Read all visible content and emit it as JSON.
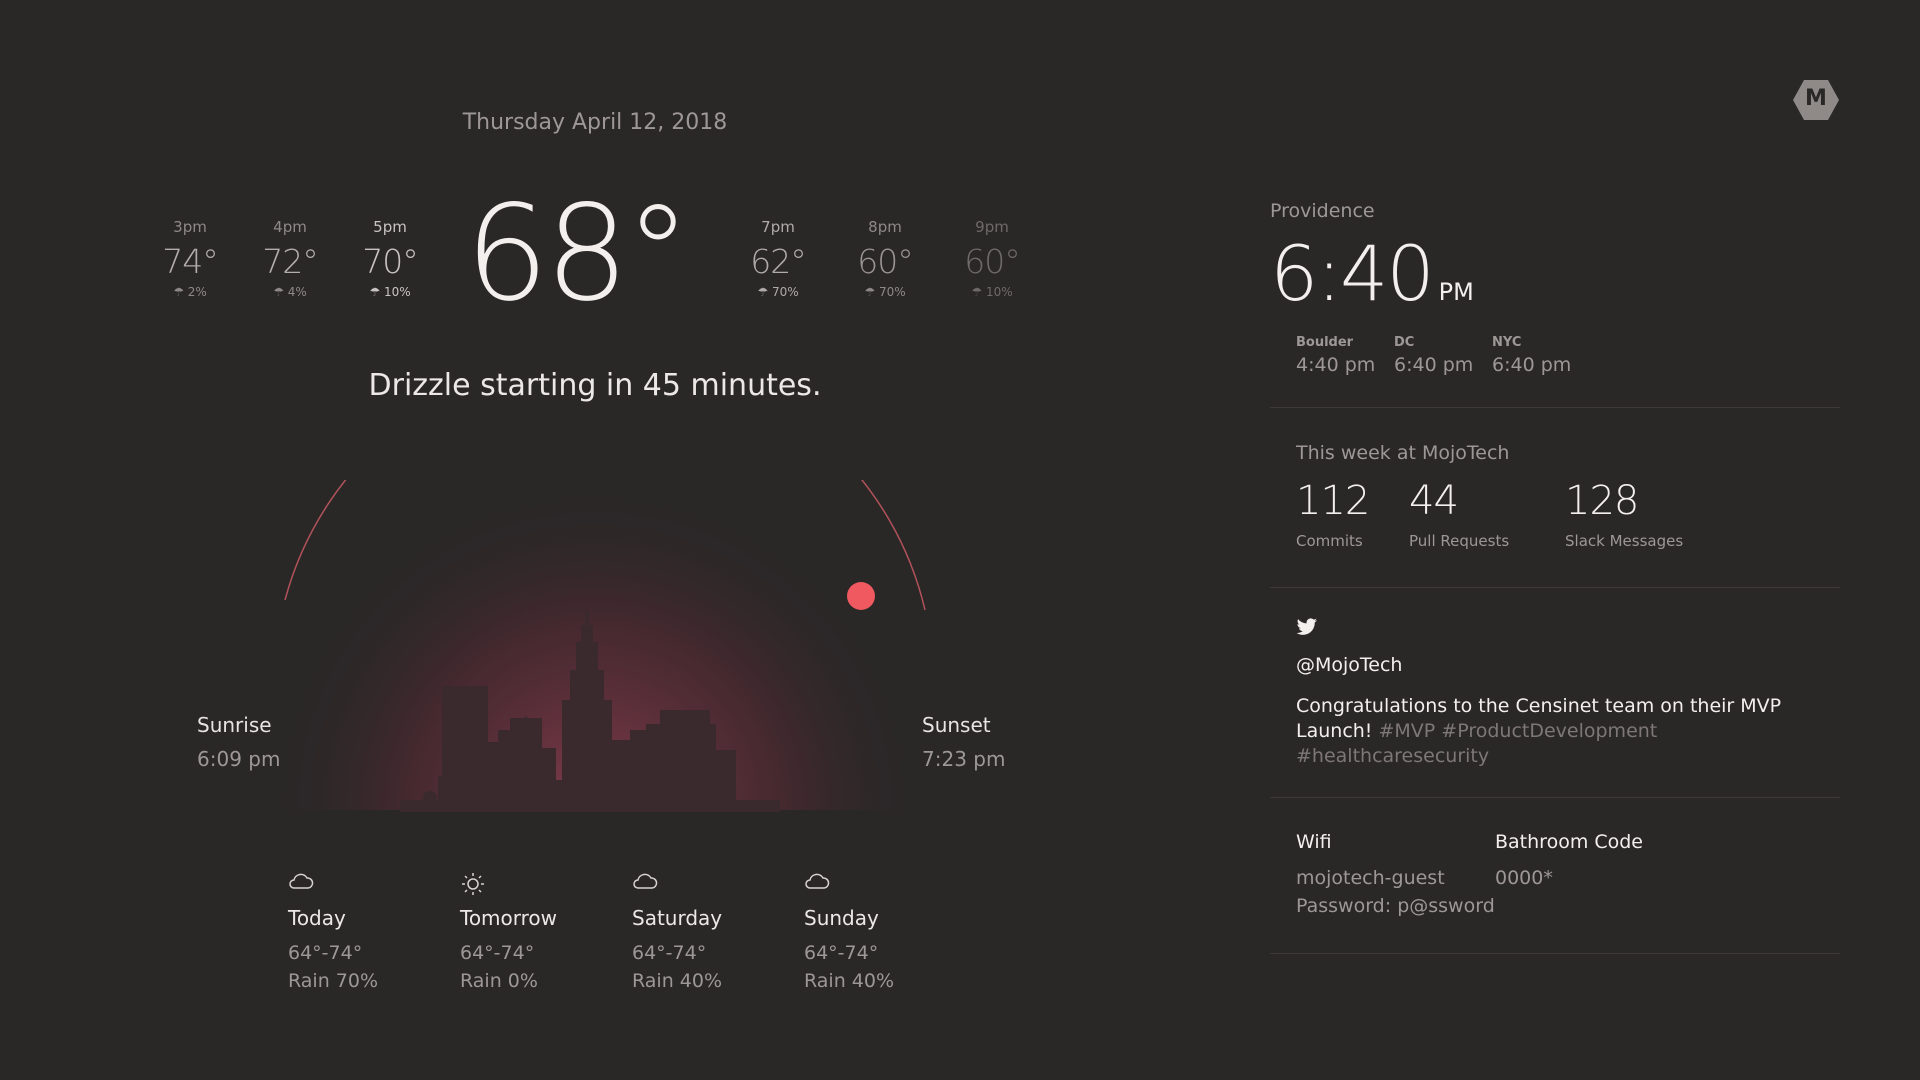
{
  "date": "Thursday April 12, 2018",
  "current_temp": "68°",
  "hourly_before": [
    {
      "time": "3pm",
      "temp": "74°",
      "rain": "2%"
    },
    {
      "time": "4pm",
      "temp": "72°",
      "rain": "4%"
    },
    {
      "time": "5pm",
      "temp": "70°",
      "rain": "10%"
    }
  ],
  "hourly_after": [
    {
      "time": "7pm",
      "temp": "62°",
      "rain": "70%"
    },
    {
      "time": "8pm",
      "temp": "60°",
      "rain": "70%"
    },
    {
      "time": "9pm",
      "temp": "60°",
      "rain": "10%"
    }
  ],
  "summary": "Drizzle starting in 45 minutes.",
  "sun": {
    "sunrise_label": "Sunrise",
    "sunrise_time": "6:09 pm",
    "sunset_label": "Sunset",
    "sunset_time": "7:23 pm",
    "arc_color": "#c85a63",
    "sun_color": "#f0595f"
  },
  "forecast": [
    {
      "icon": "cloud-icon",
      "day": "Today",
      "range": "64°-74°",
      "rain": "Rain 70%"
    },
    {
      "icon": "sun-icon",
      "day": "Tomorrow",
      "range": "64°-74°",
      "rain": "Rain 0%"
    },
    {
      "icon": "cloud-icon",
      "day": "Saturday",
      "range": "64°-74°",
      "rain": "Rain 40%"
    },
    {
      "icon": "cloud-icon",
      "day": "Sunday",
      "range": "64°-74°",
      "rain": "Rain 40%"
    }
  ],
  "logo": "M",
  "clock": {
    "city": "Providence",
    "time": "6:40",
    "ampm": "PM",
    "zones": [
      {
        "name": "Boulder",
        "time": "4:40 pm"
      },
      {
        "name": "DC",
        "time": "6:40 pm"
      },
      {
        "name": "NYC",
        "time": "6:40 pm"
      }
    ]
  },
  "week": {
    "title": "This week at MojoTech",
    "stats": [
      {
        "value": "112",
        "label": "Commits"
      },
      {
        "value": "44",
        "label": "Pull Requests"
      },
      {
        "value": "128",
        "label": "Slack Messages"
      }
    ]
  },
  "twitter": {
    "handle": "@MojoTech",
    "text": "Congratulations to the Censinet team on their MVP Launch!",
    "tags": "#MVP #ProductDevelopment #healthcaresecurity"
  },
  "info": {
    "wifi_label": "Wifi",
    "wifi_ssid": "mojotech-guest",
    "wifi_password": "Password: p@ssword",
    "bathroom_label": "Bathroom Code",
    "bathroom_code": "0000*"
  }
}
